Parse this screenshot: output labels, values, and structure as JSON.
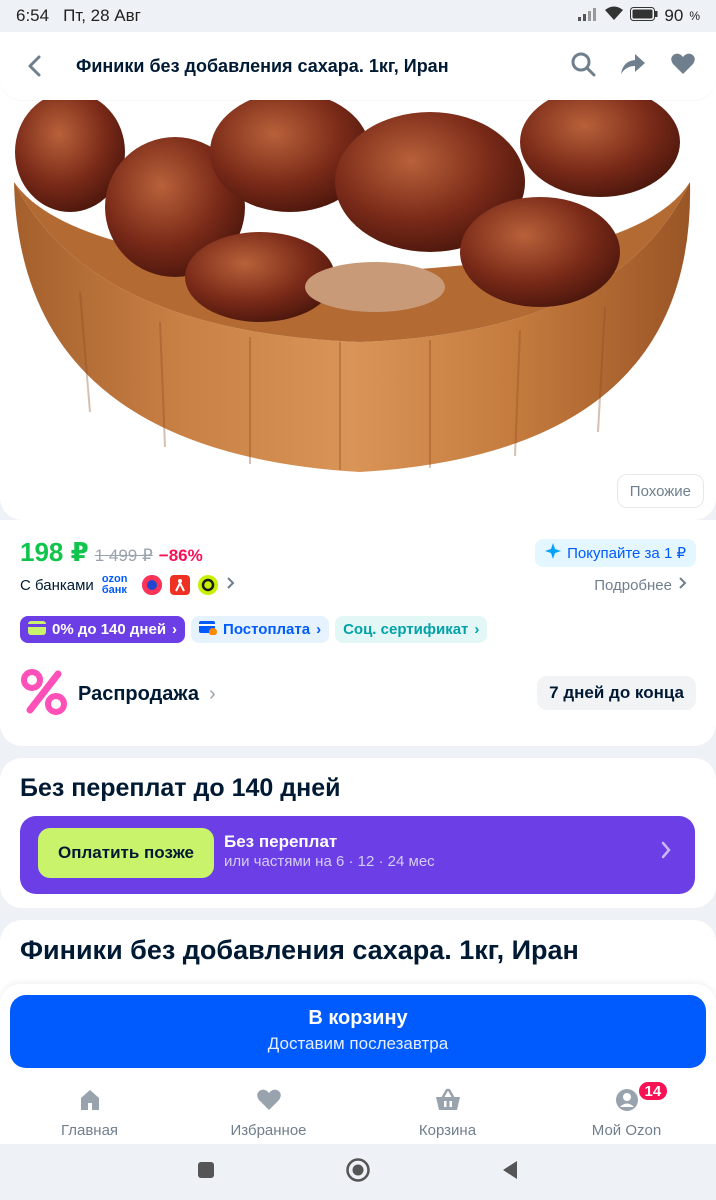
{
  "status_bar": {
    "time": "6:54",
    "date": "Пт, 28 Авг",
    "battery": "90"
  },
  "header": {
    "title": "Финики без добавления сахара. 1кг, Иран"
  },
  "image": {
    "similar_label": "Похожие"
  },
  "price": {
    "current": "198 ₽",
    "old": "1 499 ₽",
    "discount": "−86%",
    "buy_for_one": "Покупайте за 1 ₽",
    "banks_label": "С банками",
    "ozon_bank": "ozon банк",
    "more_label": "Подробнее"
  },
  "chips": {
    "installment": "0% до 140 дней",
    "postpay": "Постоплата",
    "social": "Соц. сертификат"
  },
  "sale": {
    "label": "Распродажа",
    "days_left": "7 дней до конца"
  },
  "installment": {
    "title": "Без переплат до 140 дней",
    "pay_later": "Оплатить позже",
    "line1": "Без переплат",
    "line2": "или частями на 6 · 12 · 24 мес"
  },
  "product": {
    "name": "Финики без добавления сахара. 1кг, Иран"
  },
  "cart": {
    "button": "В корзину",
    "delivery": "Доставим послезавтра"
  },
  "bottom_nav": {
    "home": "Главная",
    "favorites": "Избранное",
    "cart": "Корзина",
    "my_ozon": "Мой Ozon",
    "my_ozon_badge": "14"
  },
  "colors": {
    "accent": "#005bff",
    "price_green": "#10c44c",
    "discount_red": "#f91155",
    "installment_purple": "#6b3ee6",
    "pay_later_green": "#c9f36a"
  }
}
